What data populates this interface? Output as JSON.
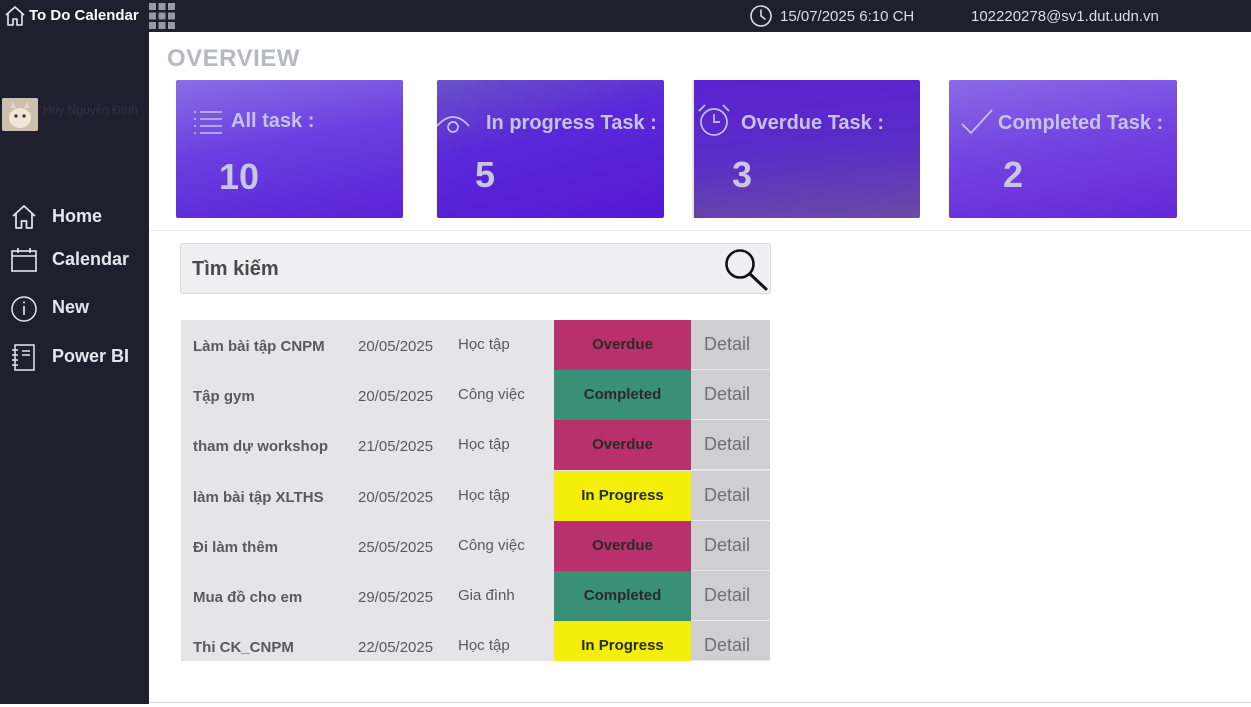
{
  "topbar": {
    "app_title": "To Do Calendar",
    "datetime": "15/07/2025 6:10 CH",
    "email": "102220278@sv1.dut.udn.vn"
  },
  "user": {
    "name": "Huy Nguyễn Đình"
  },
  "nav": [
    {
      "label": "Home",
      "icon": "home-icon"
    },
    {
      "label": "Calendar",
      "icon": "calendar-icon"
    },
    {
      "label": "New",
      "icon": "info-icon"
    },
    {
      "label": "Power BI",
      "icon": "notebook-icon"
    }
  ],
  "overview": {
    "title": "OVERVIEW",
    "cards": [
      {
        "label": "All task :",
        "value": "10",
        "icon": "list-icon"
      },
      {
        "label": "In progress Task :",
        "value": "5",
        "icon": "eye-icon"
      },
      {
        "label": "Overdue Task :",
        "value": "3",
        "icon": "alarm-clock-icon"
      },
      {
        "label": "Completed Task :",
        "value": "2",
        "icon": "check-icon"
      }
    ]
  },
  "search": {
    "placeholder": "Tìm kiếm"
  },
  "tasks": [
    {
      "name": "Làm bài tập CNPM",
      "date": "20/05/2025",
      "category": "Học tập",
      "status": "Overdue",
      "action": "Detail"
    },
    {
      "name": "Tập gym",
      "date": "20/05/2025",
      "category": "Công việc",
      "status": "Completed",
      "action": "Detail"
    },
    {
      "name": "tham dự workshop",
      "date": "21/05/2025",
      "category": "Học tập",
      "status": "Overdue",
      "action": "Detail"
    },
    {
      "name": "làm bài tập XLTHS",
      "date": "20/05/2025",
      "category": "Học tập",
      "status": "In Progress",
      "action": "Detail"
    },
    {
      "name": "Đi làm thêm",
      "date": "25/05/2025",
      "category": "Công việc",
      "status": "Overdue",
      "action": "Detail"
    },
    {
      "name": "Mua đồ cho em",
      "date": "29/05/2025",
      "category": "Gia đình",
      "status": "Completed",
      "action": "Detail"
    },
    {
      "name": "Thi CK_CNPM",
      "date": "22/05/2025",
      "category": "Học tập",
      "status": "In Progress",
      "action": "Detail"
    }
  ],
  "colors": {
    "sidebar_bg": "#1f1f2e",
    "overdue": "#b8306c",
    "completed": "#3a9077",
    "in_progress": "#f4ef08",
    "card_purple": "#5a22d6"
  }
}
